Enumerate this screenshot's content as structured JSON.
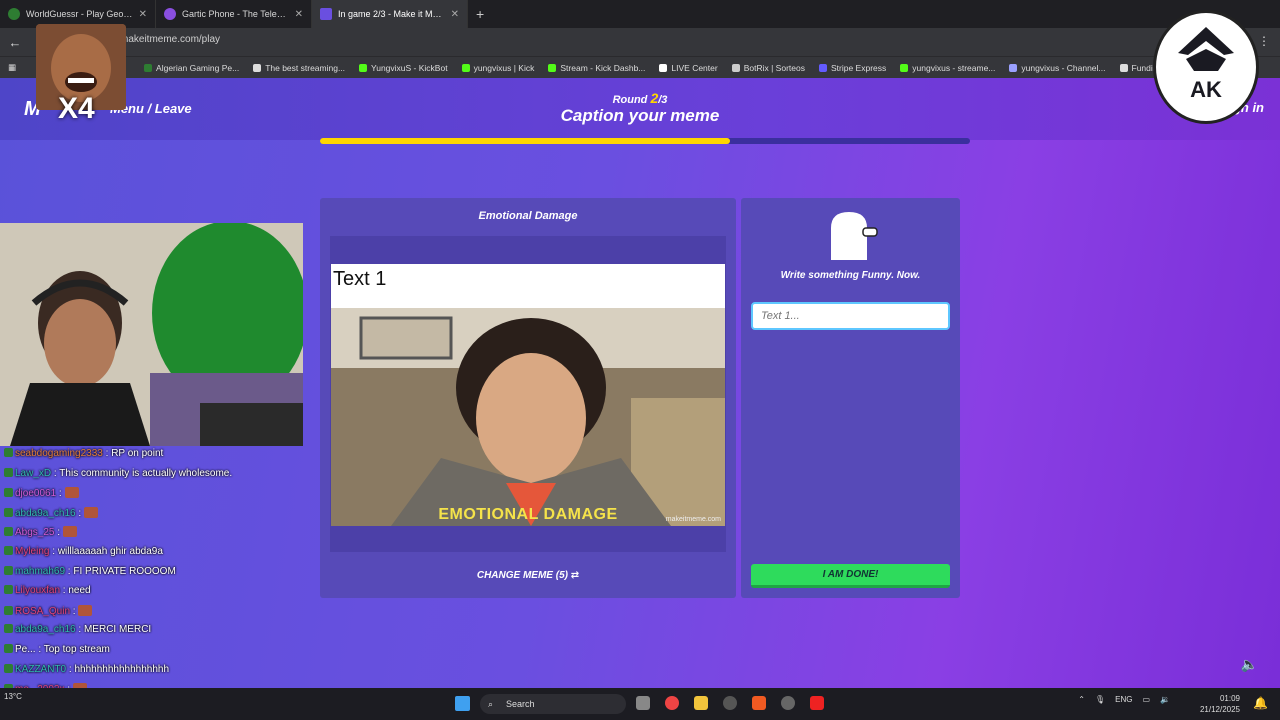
{
  "browser": {
    "tabs": [
      {
        "title": "WorldGuessr - Play Geoguessr Free",
        "active": false
      },
      {
        "title": "Gartic Phone - The Telephone Game",
        "active": false
      },
      {
        "title": "In game 2/3 - Make it Meme",
        "active": true
      }
    ],
    "new_tab": "+",
    "url": "makeitmeme.com/play",
    "bookmarks": [
      "Algerian Gaming Pe...",
      "The best streaming...",
      "YungvixuS - KickBot",
      "yungvixus | Kick",
      "Stream - Kick Dashb...",
      "LIVE Center",
      "BotRix | Sorteos",
      "Stripe Express",
      "yungvixus - streame...",
      "yungvixus - Channel...",
      "FundingPips"
    ]
  },
  "game": {
    "brand": "M",
    "menu_link": "Menu / Leave",
    "round_label": "Round",
    "round_current": "2",
    "round_total": "/3",
    "title": "Caption your meme",
    "sign_in": "gn in",
    "progress": 0.63,
    "meme_panel": {
      "title": "Emotional Damage",
      "text_box": "Text 1",
      "image_caption": "EMOTIONAL DAMAGE",
      "watermark": "makeitmeme.com",
      "change_meme": "CHANGE MEME (5)"
    },
    "caption_panel": {
      "prompt": "Write something Funny. Now.",
      "input_placeholder": "Text 1...",
      "done_button": "I AM DONE!"
    }
  },
  "overlay": {
    "emote_multiplier": "X4",
    "logo_text": "AK"
  },
  "chat": [
    {
      "user": "seabdogaming2333",
      "text": "RP on point",
      "color": "#e07b39"
    },
    {
      "user": "Law_xD",
      "text": "This community is actually wholesome.",
      "color": "#2fb8b0"
    },
    {
      "user": "djoe0061",
      "text": "",
      "color": "#d15ad6"
    },
    {
      "user": "abda9a_ch16",
      "text": "",
      "color": "#2fb8b0"
    },
    {
      "user": "Abgs_25",
      "text": "",
      "color": "#d15ad6"
    },
    {
      "user": "Myleing",
      "text": "willlaaaaah ghir abda9a",
      "color": "#e0427a"
    },
    {
      "user": "mahmah69",
      "text": "FI PRIVATE ROOOOM",
      "color": "#2fb8b0"
    },
    {
      "user": "Lilyouxfan",
      "text": "need",
      "color": "#e0427a"
    },
    {
      "user": "ROSA_Quin",
      "text": "",
      "color": "#e0427a"
    },
    {
      "user": "abda9a_ch16",
      "text": "MERCI MERCI",
      "color": "#2fb8b0"
    },
    {
      "user": "Pe...",
      "text": "Top top stream",
      "color": "#fff"
    },
    {
      "user": "KAZZANT0",
      "text": "hhhhhhhhhhhhhhhhh",
      "color": "#2fb8b0"
    },
    {
      "user": "mo...2002x",
      "text": "",
      "color": "#e0427a"
    }
  ],
  "taskbar": {
    "search": "Search",
    "lang": "ENG",
    "time": "01:09",
    "date": "21/12/2025",
    "weather": "13°C"
  }
}
